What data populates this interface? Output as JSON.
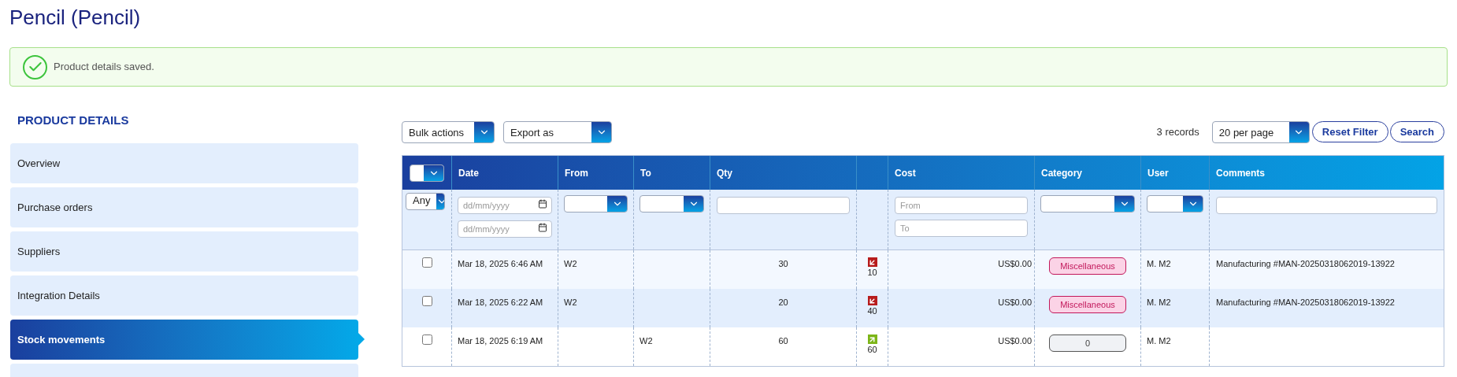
{
  "page_title": "Pencil (Pencil)",
  "alert": {
    "kind": "success",
    "message": "Product details saved."
  },
  "sidebar": {
    "heading": "PRODUCT DETAILS",
    "items": [
      {
        "label": "Overview",
        "selected": false
      },
      {
        "label": "Purchase orders",
        "selected": false
      },
      {
        "label": "Suppliers",
        "selected": false
      },
      {
        "label": "Integration Details",
        "selected": false
      },
      {
        "label": "Stock movements",
        "selected": true
      }
    ]
  },
  "toolbar": {
    "bulk_actions": "Bulk actions",
    "export": "Export as",
    "records": "3 records",
    "per_page": "20 per page",
    "reset_button": "Reset Filter",
    "search_button": "Search"
  },
  "table": {
    "columns": [
      "Date",
      "From",
      "To",
      "Qty",
      "",
      "Cost",
      "Category",
      "User",
      "Comments"
    ],
    "filters": {
      "select_all": "Any",
      "date_from_placeholder": "dd/mm/yyyy",
      "date_to_placeholder": "dd/mm/yyyy",
      "cost_from_placeholder": "From",
      "cost_to_placeholder": "To"
    },
    "rows": [
      {
        "checked": false,
        "date": "Mar 18, 2025 6:46 AM",
        "from": "W2",
        "to": "",
        "qty": "30",
        "incoming": false,
        "stock": "10",
        "cost": "US$0.00",
        "category": {
          "kind": "tag",
          "label": "Miscellaneous"
        },
        "user": "M. M2",
        "comments": "Manufacturing #MAN-20250318062019-13922"
      },
      {
        "checked": false,
        "date": "Mar 18, 2025 6:22 AM",
        "from": "W2",
        "to": "",
        "qty": "20",
        "incoming": false,
        "stock": "40",
        "cost": "US$0.00",
        "category": {
          "kind": "tag",
          "label": "Miscellaneous"
        },
        "user": "M. M2",
        "comments": "Manufacturing #MAN-20250318062019-13922"
      },
      {
        "checked": false,
        "date": "Mar 18, 2025 6:19 AM",
        "from": "",
        "to": "W2",
        "qty": "60",
        "incoming": true,
        "stock": "60",
        "cost": "US$0.00",
        "category": {
          "kind": "empty",
          "label": "0"
        },
        "user": "M. M2",
        "comments": ""
      }
    ]
  }
}
